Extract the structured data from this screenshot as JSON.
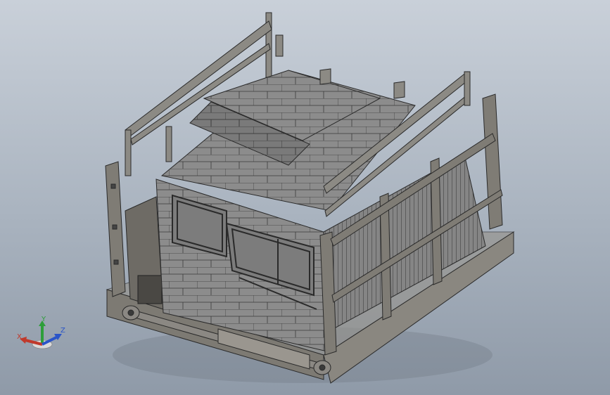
{
  "viewport": {
    "background_top": "#c9d0d9",
    "background_bottom": "#8f9aa8",
    "model_color": "#8a8a8a",
    "edge_color": "#2a2a2a"
  },
  "triad": {
    "x_label": "X",
    "y_label": "Y",
    "z_label": "Z",
    "x_color": "#c0392b",
    "y_color": "#2e9e3a",
    "z_color": "#2b55c8"
  }
}
